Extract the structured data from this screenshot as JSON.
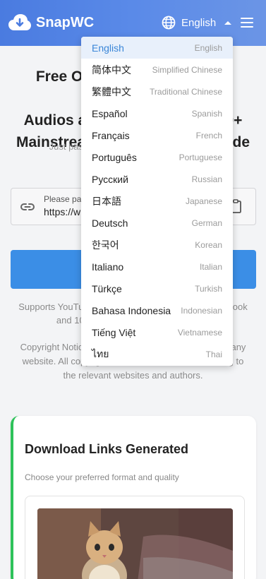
{
  "header": {
    "brand": "SnapWC",
    "language_label": "English",
    "icons": {
      "logo": "cloud-download-icon",
      "globe": "globe-icon",
      "caret": "caret-up-icon",
      "menu": "hamburger-menu-icon"
    }
  },
  "hero": {
    "title_lines": [
      "Free Online Downloader for Videos,",
      "Audios and Images from 1000+",
      "Mainstream Platforms Worldwide"
    ],
    "subtitle": "Just paste the link to download video and"
  },
  "url_input": {
    "placeholder": "Please paste the link here",
    "value": "https://w",
    "icons": {
      "link": "link-icon",
      "paste": "clipboard-icon"
    }
  },
  "download_button": {
    "label": ""
  },
  "supports_text": "Supports YouTube, TikTok, Instagram, Twitter, Facebook and 1000+ other platforms worldwide.",
  "copyright_text": "Copyright Notice: We do not store any content from any website. All copyrights of the videos involved belong to the relevant websites and authors.",
  "result_card": {
    "title": "Download Links Generated",
    "subtitle": "Choose your preferred format and quality",
    "accent_color": "#2ec25a"
  },
  "language_menu": {
    "selected": "English",
    "items": [
      {
        "native": "English",
        "english": "English"
      },
      {
        "native": "简体中文",
        "english": "Simplified Chinese"
      },
      {
        "native": "繁體中文",
        "english": "Traditional Chinese"
      },
      {
        "native": "Español",
        "english": "Spanish"
      },
      {
        "native": "Français",
        "english": "French"
      },
      {
        "native": "Português",
        "english": "Portuguese"
      },
      {
        "native": "Русский",
        "english": "Russian"
      },
      {
        "native": "日本語",
        "english": "Japanese"
      },
      {
        "native": "Deutsch",
        "english": "German"
      },
      {
        "native": "한국어",
        "english": "Korean"
      },
      {
        "native": "Italiano",
        "english": "Italian"
      },
      {
        "native": "Türkçe",
        "english": "Turkish"
      },
      {
        "native": "Bahasa Indonesia",
        "english": "Indonesian"
      },
      {
        "native": "Tiếng Việt",
        "english": "Vietnamese"
      },
      {
        "native": "ไทย",
        "english": "Thai"
      }
    ]
  },
  "colors": {
    "header_start": "#4a7be0",
    "header_end": "#6b95e6",
    "primary_button": "#3b8ee6",
    "active_lang": "#3a86d8",
    "active_lang_bg": "#e8f0fb"
  }
}
